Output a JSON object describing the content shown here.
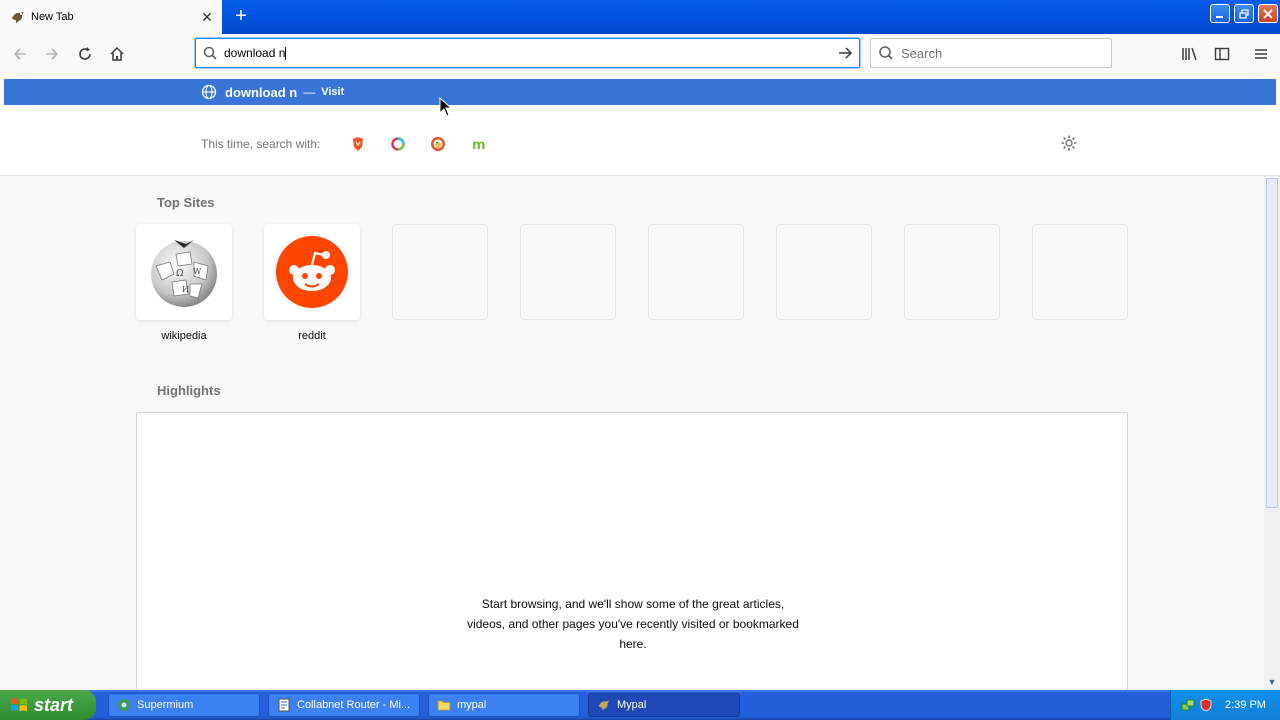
{
  "browser": {
    "tab": {
      "title": "New Tab"
    },
    "urlbar": {
      "value": "download n"
    },
    "searchbar": {
      "placeholder": "Search"
    }
  },
  "autocomplete": {
    "row": {
      "text": "download n",
      "separator": "—",
      "action": "Visit"
    },
    "oneoff_label": "This time, search with:",
    "engines": [
      "brave-search",
      "qwant",
      "duckduckgo",
      "mojeek"
    ]
  },
  "newtab": {
    "top_sites_title": "Top Sites",
    "sites": [
      {
        "label": "wikipedia"
      },
      {
        "label": "reddit"
      }
    ],
    "highlights_title": "Highlights",
    "empty_message": "Start browsing, and we'll show some of the great articles, videos, and other pages you've recently visited or bookmarked here."
  },
  "taskbar": {
    "start_label": "start",
    "items": [
      "Supermium",
      "Collabnet Router - Mi...",
      "mypal",
      "Mypal"
    ],
    "clock": "2:39 PM"
  },
  "colors": {
    "accent": "#0a84ff",
    "autocomplete_selected": "#3875d7",
    "reddit": "#ff4500"
  }
}
